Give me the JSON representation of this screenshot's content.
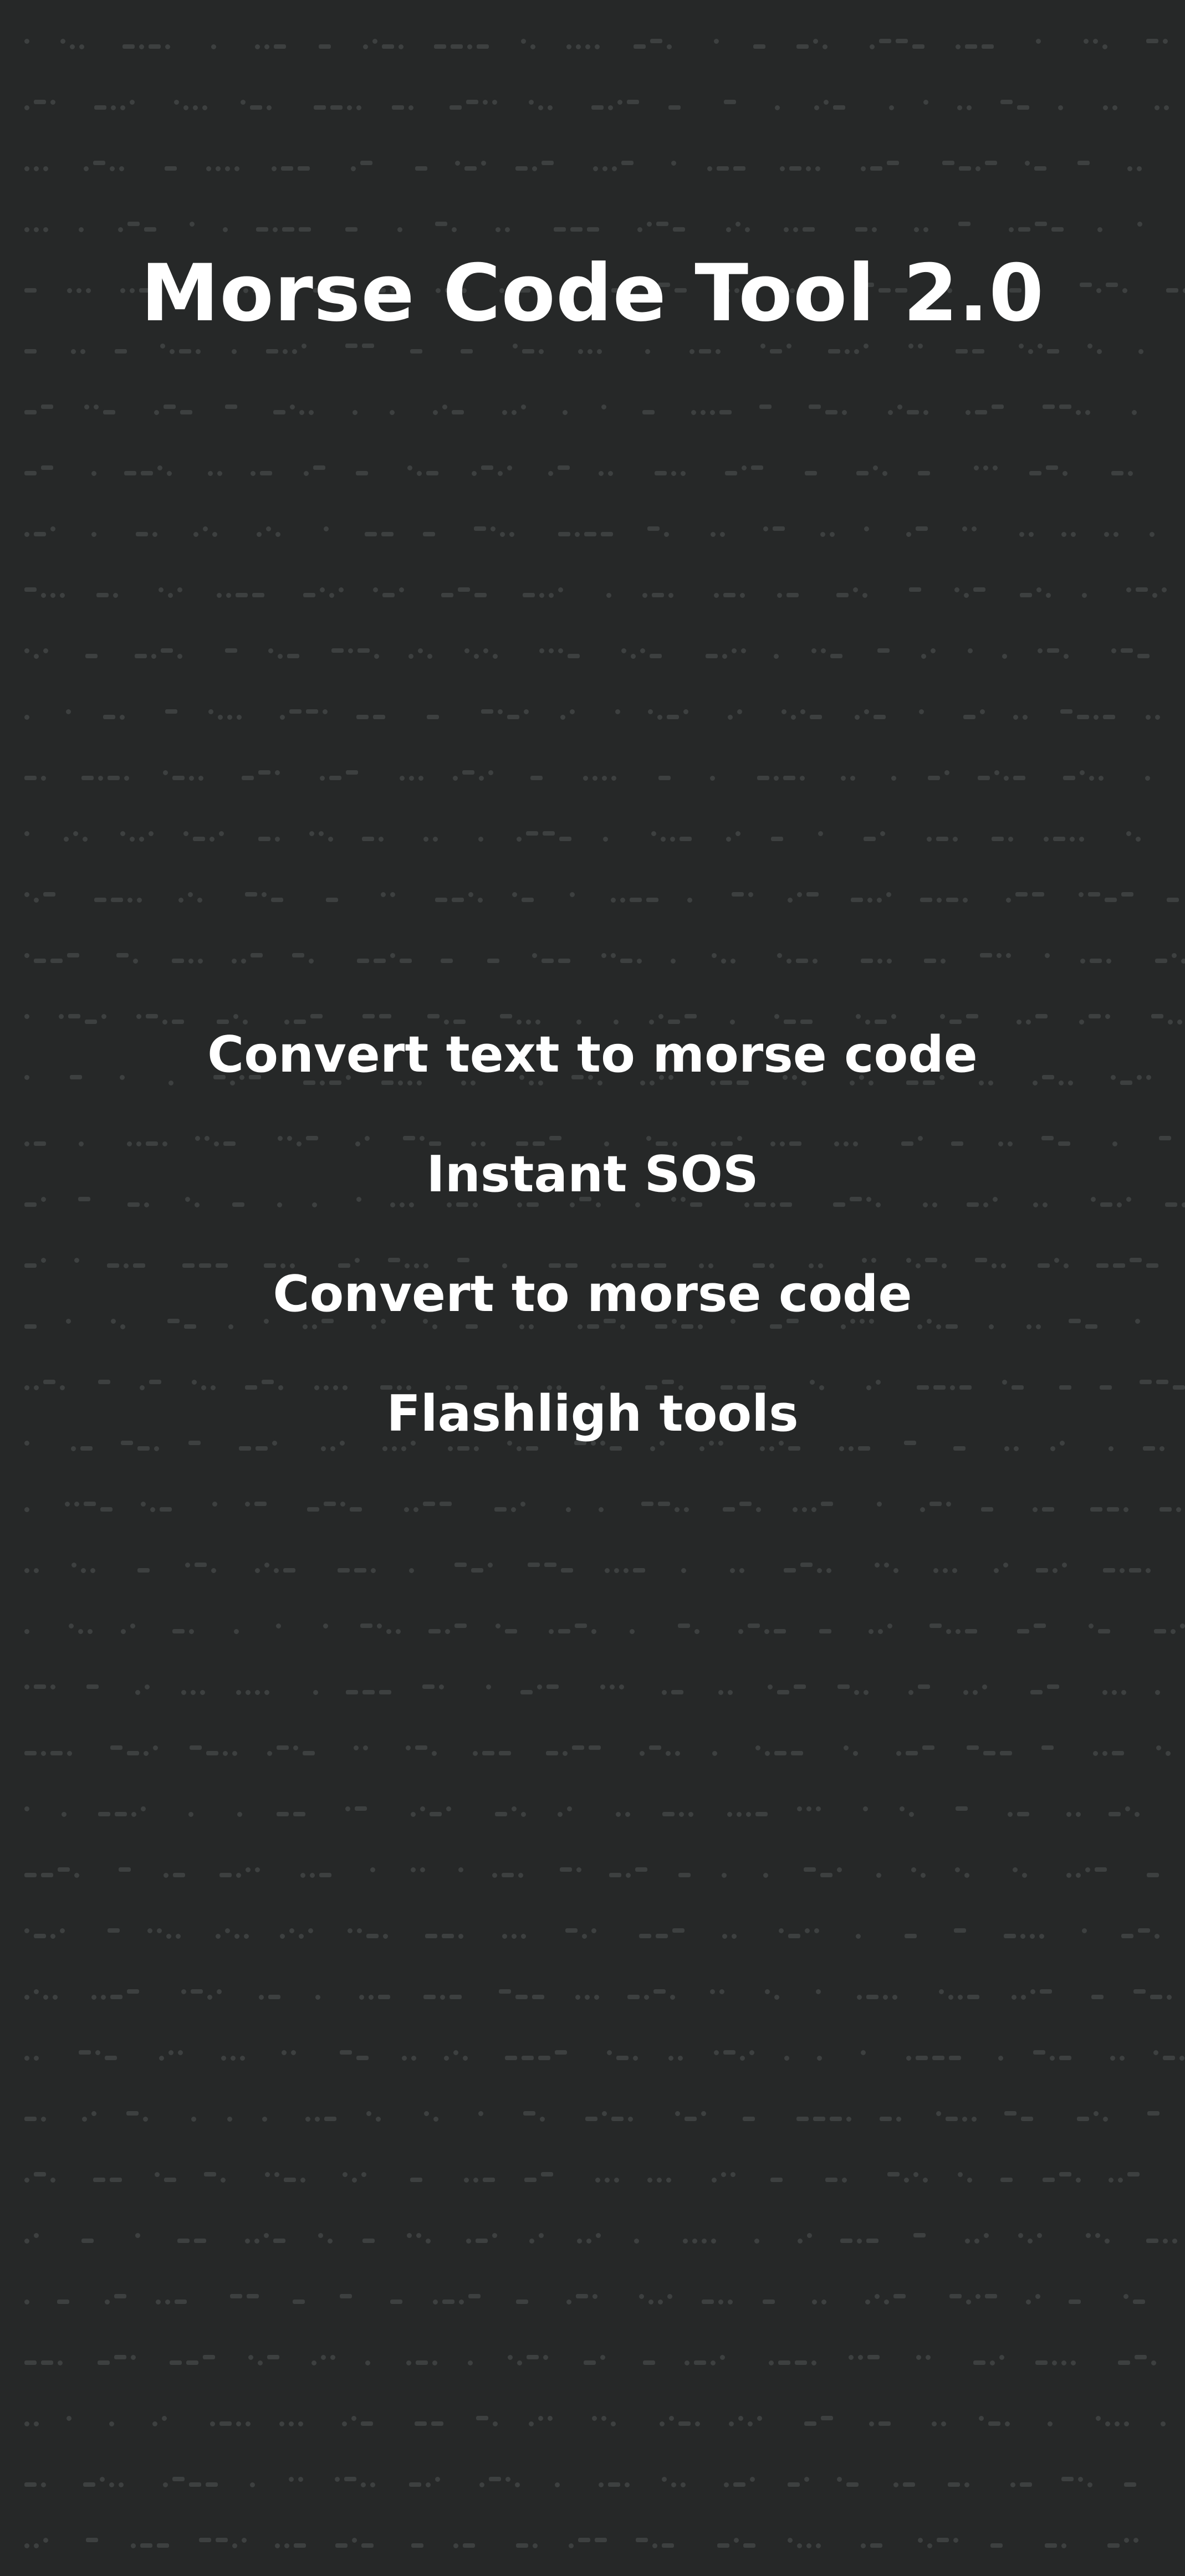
{
  "app": {
    "title": "Morse Code Tool 2.0"
  },
  "menu": {
    "items": [
      {
        "label": "Convert text to morse code"
      },
      {
        "label": "Instant SOS"
      },
      {
        "label": "Convert to morse code"
      },
      {
        "label": "Flashligh tools"
      }
    ]
  },
  "theme": {
    "background": "#262828",
    "pattern_color": "#3d4040",
    "text_color": "#ffffff"
  }
}
